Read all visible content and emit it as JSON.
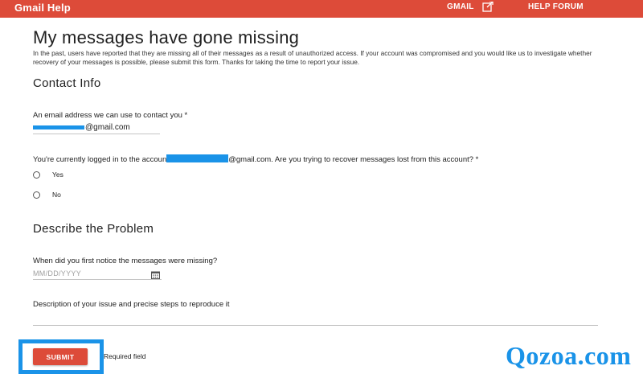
{
  "topbar": {
    "brand": "Gmail Help",
    "gmail_link": "GMAIL",
    "help_forum": "HELP FORUM",
    "bg_color": "#dd4b39"
  },
  "page": {
    "title": "My messages have gone missing",
    "intro": "In the past, users have reported that they are missing all of their messages as a result of unauthorized access. If your account was compromised and you would like us to investigate whether recovery of your messages is possible, please submit this form. Thanks for taking the time to report your issue."
  },
  "contact": {
    "heading": "Contact Info",
    "email_label": "An email address we can use to contact you *",
    "email_value_suffix": "@gmail.com",
    "account_question_prefix": "You're currently logged in to the accoun",
    "account_question_suffix": "@gmail.com. Are you trying to recover messages lost from this account? *",
    "options": [
      "Yes",
      "No"
    ]
  },
  "problem": {
    "heading": "Describe the Problem",
    "date_label": "When did you first notice the messages were missing?",
    "date_placeholder": "MM/DD/YYYY",
    "description_label": "Description of your issue and precise steps to reproduce it"
  },
  "footer": {
    "submit_label": "SUBMIT",
    "required_note": "Required field"
  },
  "watermark": "Qozoa.com",
  "icons": {
    "external_link": "external-link-icon",
    "calendar": "calendar-icon"
  }
}
